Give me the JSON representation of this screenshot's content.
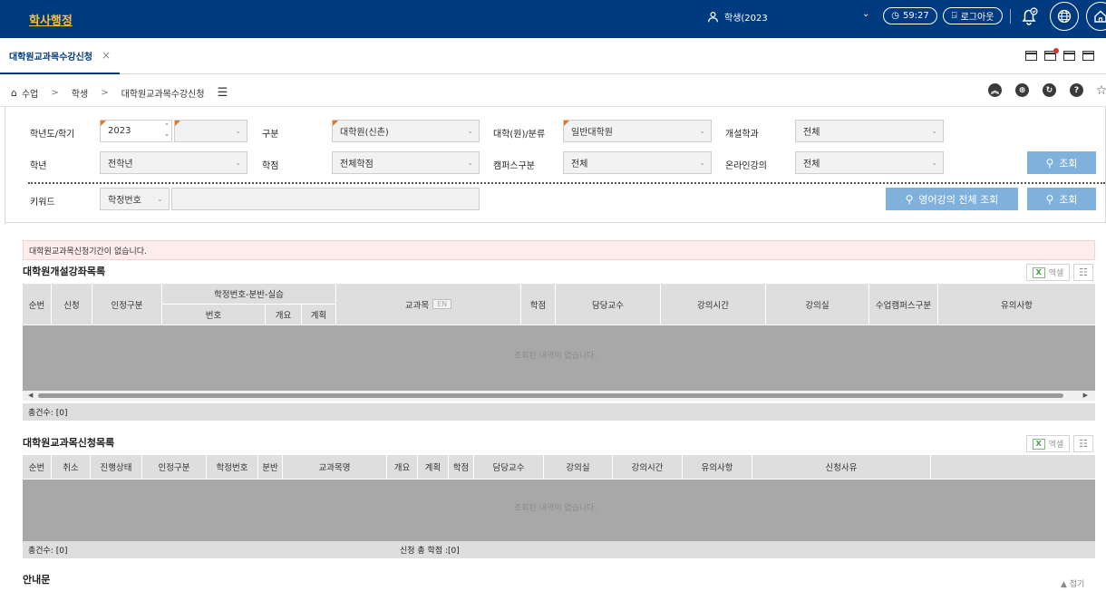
{
  "header": {
    "brand": "학사행정",
    "user": "학생(2023",
    "timer": "59:27",
    "logout": "로그아웃"
  },
  "tab": {
    "label": "대학원교과목수강신청",
    "close": "×"
  },
  "breadcrumb": {
    "items": [
      "수업",
      "학생",
      "대학원교과목수강신청"
    ],
    "sep": ">"
  },
  "toolbar_icons": [
    "chevron-up-icon",
    "network-icon",
    "refresh-icon",
    "help-icon",
    "star-icon"
  ],
  "search": {
    "labels": {
      "year_term": "학년도/학기",
      "category": "구분",
      "college": "대학(원)/분류",
      "dept": "개설학과",
      "grade": "학년",
      "credit": "학점",
      "campus": "캠퍼스구분",
      "online": "온라인강의",
      "keyword": "키워드"
    },
    "values": {
      "year": "2023",
      "term": "",
      "category": "대학원(신촌)",
      "college": "일반대학원",
      "dept": "전체",
      "grade": "전학년",
      "credit": "전체학점",
      "campus": "전체",
      "online": "전체",
      "keyword_type": "학정번호",
      "keyword": ""
    },
    "buttons": {
      "search1": "조회",
      "english_all": "영어강의 전체 조회",
      "search2": "조회"
    }
  },
  "notice": "대학원교과목신청기간이 없습니다.",
  "offered": {
    "title": "대학원개설강좌목록",
    "excel": "엑셀",
    "headers": {
      "no": "순번",
      "apply": "신청",
      "cert": "인정구분",
      "code_group": "학정번호-분반-실습",
      "code": "번호",
      "summary": "개요",
      "plan": "계획",
      "course": "교과목",
      "en": "EN",
      "credit": "학점",
      "prof": "담당교수",
      "time": "강의시간",
      "room": "강의실",
      "campus": "수업캠퍼스구분",
      "note": "유의사항"
    },
    "empty": "조회된 내역이 없습니다.",
    "total": "총건수: [0]"
  },
  "applied": {
    "title": "대학원교과목신청목록",
    "excel": "엑셀",
    "headers": [
      "순번",
      "취소",
      "진행상태",
      "인정구분",
      "학정번호",
      "분반",
      "교과목명",
      "개요",
      "계획",
      "학점",
      "담당교수",
      "강의실",
      "강의시간",
      "유의사항",
      "신청사유"
    ],
    "empty": "조회된 내역이 없습니다.",
    "total": "총건수: [0]",
    "total_credit": "신청 총 학점 :[0]"
  },
  "guide": {
    "title": "안내문",
    "fold": "▲ 접기"
  },
  "colors": {
    "header_bg": "#003b80",
    "brand": "#f4c03a",
    "button": "#80b1dc",
    "grid_empty": "#a8a8a8"
  }
}
